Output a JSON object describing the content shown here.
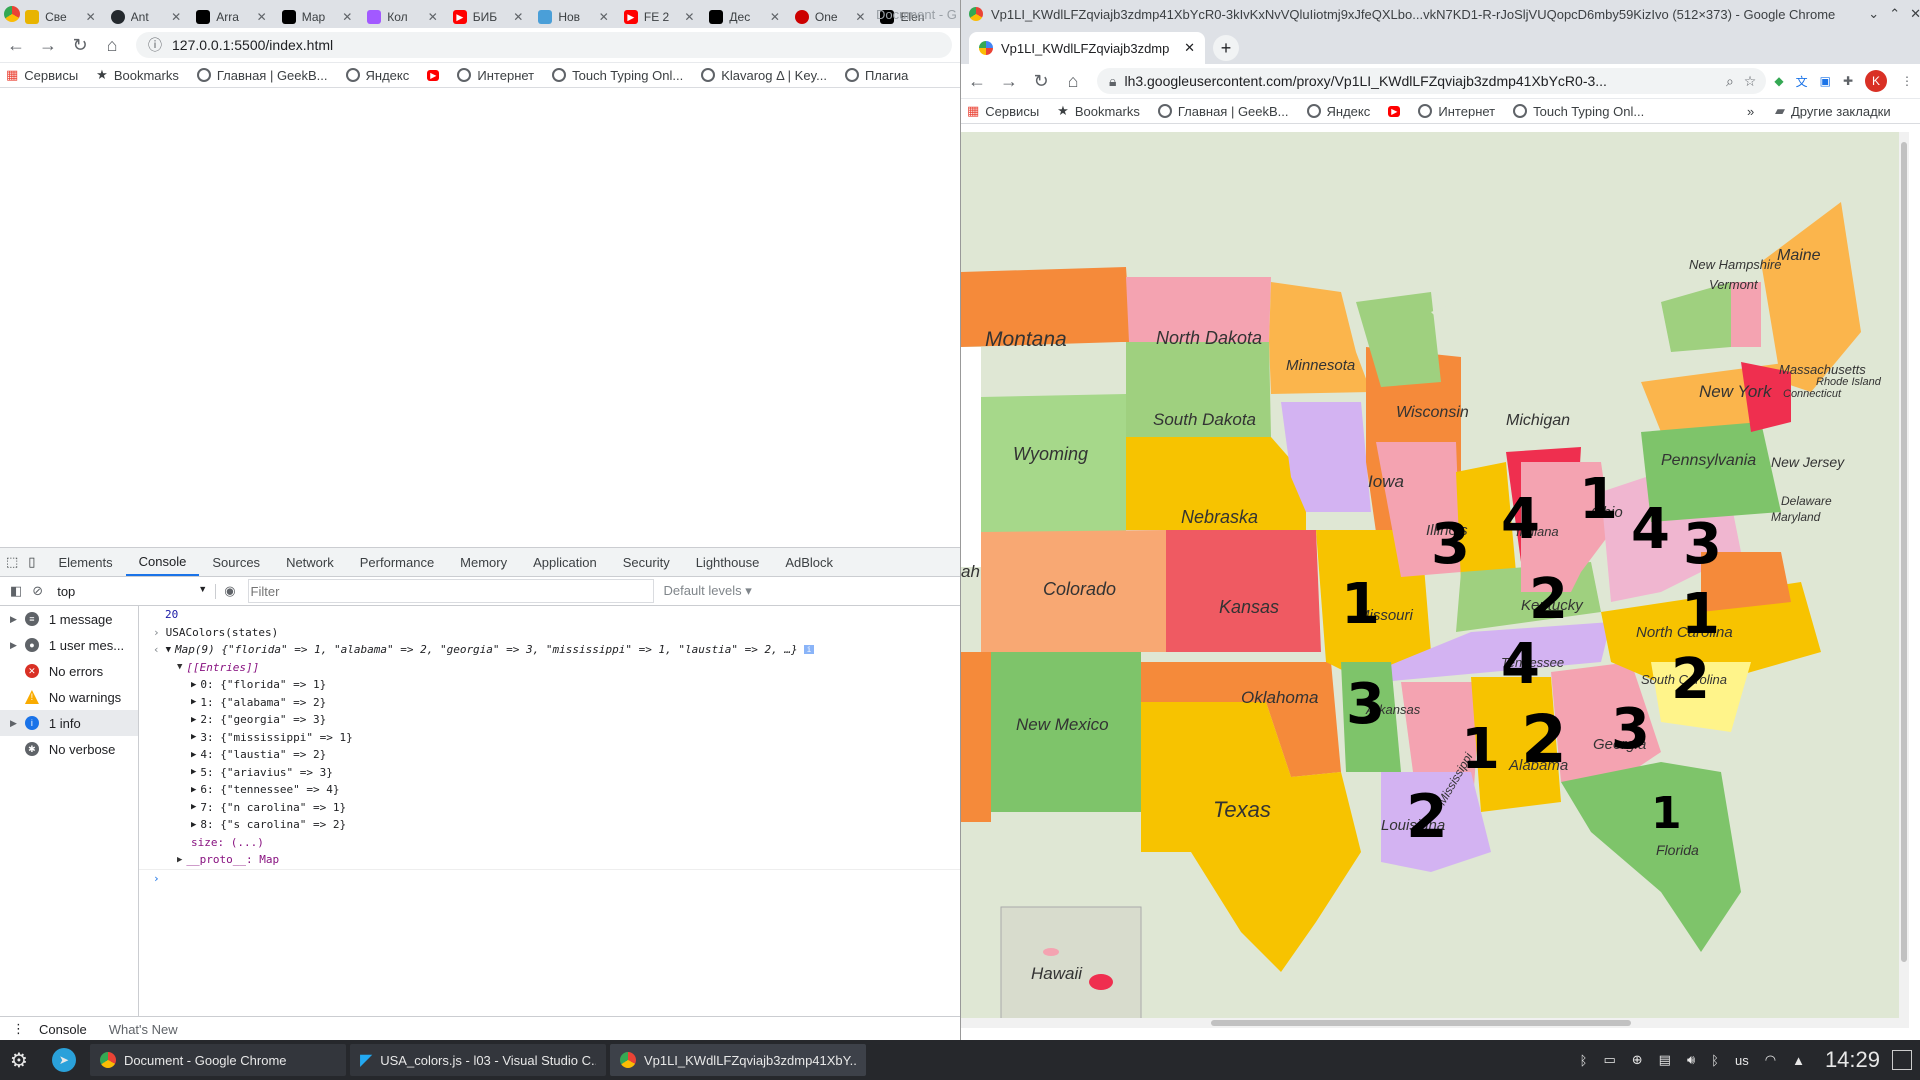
{
  "left_window": {
    "title_fragment": "Document - G",
    "tabs": [
      {
        "label": "Све",
        "color": "#e8b400"
      },
      {
        "label": "Ant",
        "color": "#24292e"
      },
      {
        "label": "Arra",
        "color": "#000000"
      },
      {
        "label": "Мар",
        "color": "#000000"
      },
      {
        "label": "Кол",
        "color": "#a259ff"
      },
      {
        "label": "БИБ",
        "color": "#ff0000"
      },
      {
        "label": "Нов",
        "color": "#4a9fd8"
      },
      {
        "label": "FE 2",
        "color": "#ff0000"
      },
      {
        "label": "Дес",
        "color": "#000000"
      },
      {
        "label": "One",
        "color": "#cc0000"
      },
      {
        "label": "Elen",
        "color": "#000000"
      }
    ],
    "url": "127.0.0.1:5500/index.html",
    "bookmarks": [
      "Сервисы",
      "Bookmarks",
      "Главная | GeekB...",
      "Яндекс",
      "",
      "Интернет",
      "Touch Typing Onl...",
      "Klavarog Δ | Key...",
      "Плагиа"
    ],
    "devtools": {
      "tabs": [
        "Elements",
        "Console",
        "Sources",
        "Network",
        "Performance",
        "Memory",
        "Application",
        "Security",
        "Lighthouse",
        "AdBlock"
      ],
      "active_tab": "Console",
      "context": "top",
      "filter_placeholder": "Filter",
      "levels": "Default levels ▾",
      "sidebar": [
        {
          "label": "1 message",
          "icon": "list-icon",
          "color": "#5f6368"
        },
        {
          "label": "1 user mes...",
          "icon": "user-icon",
          "color": "#5f6368"
        },
        {
          "label": "No errors",
          "icon": "error-icon",
          "color": "#d93025"
        },
        {
          "label": "No warnings",
          "icon": "warning-icon",
          "color": "#f9ab00"
        },
        {
          "label": "1 info",
          "icon": "info-icon",
          "color": "#1a73e8"
        },
        {
          "label": "No verbose",
          "icon": "bug-icon",
          "color": "#5f6368"
        }
      ],
      "console": {
        "number": "20",
        "input_cmd": "USAColors(states)",
        "map_summary": "Map(9) {\"florida\" => 1, \"alabama\" => 2, \"georgia\" => 3, \"mississippi\" => 1, \"laustia\" => 2, …}",
        "entries_label": "[[Entries]]",
        "entries": [
          "0: {\"florida\" => 1}",
          "1: {\"alabama\" => 2}",
          "2: {\"georgia\" => 3}",
          "3: {\"mississippi\" => 1}",
          "4: {\"laustia\" => 2}",
          "5: {\"ariavius\" => 3}",
          "6: {\"tennessee\" => 4}",
          "7: {\"n carolina\" => 1}",
          "8: {\"s carolina\" => 2}"
        ],
        "size_line": "size: (...)",
        "proto_line": "__proto__: Map"
      },
      "drawer_tabs": [
        "Console",
        "What's New"
      ]
    }
  },
  "right_window": {
    "title": "Vp1LI_KWdlLFZqviajb3zdmp41XbYcR0-3kIvKxNvVQluIiotmj9xJfeQXLbo...vkN7KD1-R-rJoSljVUQopcD6mby59KizIvo (512×373) - Google Chrome",
    "tab_label": "Vp1LI_KWdlLFZqviajb3zdmp",
    "url": "lh3.googleusercontent.com/proxy/Vp1LI_KWdlLFZqviajb3zdmp41XbYcR0-3...",
    "bookmarks": [
      "Сервисы",
      "Bookmarks",
      "Главная | GeekB...",
      "Яндекс",
      "",
      "Интернет",
      "Touch Typing Onl..."
    ],
    "other_bookmarks": "Другие закладки",
    "profile_initial": "K",
    "map_states": [
      "Montana",
      "North Dakota",
      "Minnesota",
      "Wisconsin",
      "Michigan",
      "Maine",
      "New Hampshire",
      "Vermont",
      "Massachusetts",
      "Rhode Island",
      "Connecticut",
      "New York",
      "Pennsylvania",
      "New Jersey",
      "Delaware",
      "Maryland",
      "Wyoming",
      "South Dakota",
      "Iowa",
      "Illinois",
      "Indiana",
      "Ohio",
      "Nebraska",
      "Colorado",
      "Kansas",
      "Missouri",
      "Kentucky",
      "North Carolina",
      "Tennessee",
      "South Carolina",
      "Oklahoma",
      "Arkansas",
      "New Mexico",
      "Georgia",
      "Alabama",
      "Mississippi",
      "Texas",
      "Louisiana",
      "Florida",
      "Hawaii",
      "Virginia",
      "ah"
    ],
    "handwritten_numbers": [
      "3",
      "4",
      "1",
      "4",
      "3",
      "1",
      "2",
      "1",
      "4",
      "2",
      "3",
      "1",
      "2",
      "3",
      "2",
      "1"
    ]
  },
  "taskbar": {
    "items": [
      "Document - Google Chrome",
      "USA_colors.js - l03 - Visual Studio C...",
      "Vp1LI_KWdlLFZqviajb3zdmp41XbY..."
    ],
    "keyboard": "us",
    "time": "14:29"
  }
}
